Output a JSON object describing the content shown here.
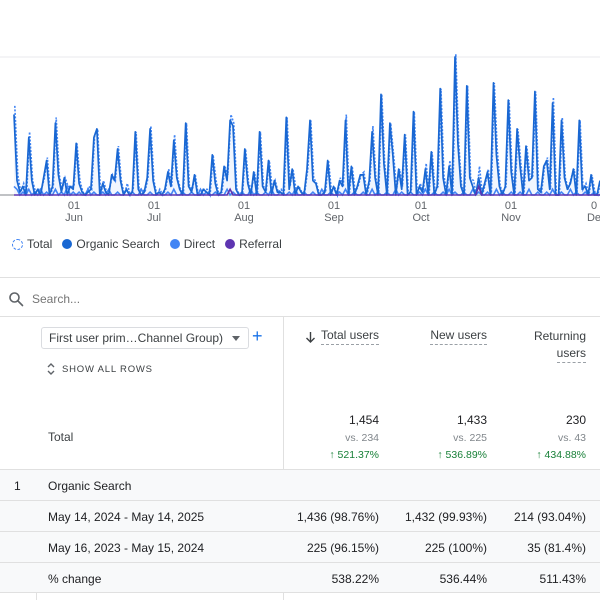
{
  "chart_data": {
    "type": "line",
    "x_ticks": [
      {
        "day": "01",
        "month": "Jun"
      },
      {
        "day": "01",
        "month": "Jul"
      },
      {
        "day": "01",
        "month": "Aug"
      },
      {
        "day": "01",
        "month": "Sep"
      },
      {
        "day": "01",
        "month": "Oct"
      },
      {
        "day": "01",
        "month": "Nov"
      },
      {
        "day": "0",
        "month": "De"
      }
    ],
    "series": [
      {
        "name": "Total",
        "color": "#4285f4",
        "style": "dashed"
      },
      {
        "name": "Organic Search",
        "color": "#1967d2",
        "style": "solid"
      },
      {
        "name": "Direct",
        "color": "#4285f4",
        "style": "solid"
      },
      {
        "name": "Referral",
        "color": "#5e35b1",
        "style": "solid"
      }
    ],
    "organic_values": [
      28,
      5,
      1,
      3,
      0,
      20,
      5,
      0,
      2,
      0,
      6,
      12,
      0,
      3,
      25,
      7,
      1,
      6,
      0,
      3,
      2,
      18,
      4,
      1,
      0,
      1,
      2,
      20,
      23,
      0,
      4,
      1,
      0,
      7,
      5,
      16,
      5,
      0,
      2,
      0,
      1,
      22,
      2,
      0,
      1,
      6,
      23,
      5,
      0,
      1,
      0,
      2,
      8,
      3,
      19,
      6,
      2,
      0,
      25,
      3,
      1,
      7,
      0,
      0,
      2,
      1,
      0,
      14,
      4,
      0,
      1,
      10,
      5,
      26,
      24,
      2,
      0,
      0,
      16,
      4,
      0,
      8,
      0,
      22,
      3,
      1,
      12,
      0,
      5,
      1,
      1,
      0,
      27,
      2,
      9,
      0,
      3,
      1,
      0,
      9,
      26,
      5,
      4,
      0,
      0,
      1,
      12,
      0,
      3,
      0,
      5,
      3,
      26,
      0,
      10,
      0,
      3,
      7,
      7,
      0,
      5,
      22,
      6,
      0,
      35,
      11,
      0,
      25,
      14,
      0,
      9,
      2,
      21,
      0,
      1,
      29,
      0,
      3,
      1,
      9,
      0,
      15,
      0,
      3,
      37,
      6,
      0,
      10,
      0,
      48,
      18,
      3,
      0,
      38,
      6,
      3,
      0,
      6,
      0,
      4,
      8,
      0,
      39,
      14,
      3,
      0,
      3,
      33,
      8,
      0,
      23,
      10,
      0,
      17,
      5,
      6,
      36,
      2,
      1,
      10,
      12,
      2,
      32,
      0,
      0,
      26,
      6,
      2,
      4,
      9,
      0,
      26,
      2,
      3,
      0,
      7,
      0,
      0,
      5
    ],
    "direct_values": [
      3,
      2,
      0,
      1,
      0,
      2,
      0,
      1,
      0,
      2,
      0,
      1,
      0,
      0,
      2,
      0,
      1,
      0,
      3,
      0,
      1,
      0,
      1,
      0,
      0,
      2,
      0,
      1,
      0,
      0,
      1,
      0,
      2,
      0,
      0,
      1,
      0,
      0,
      2,
      0,
      1,
      0,
      0,
      2,
      0,
      0,
      1,
      0,
      0,
      1,
      0,
      0,
      1,
      0,
      2,
      0,
      0,
      1,
      0,
      0,
      1,
      0,
      0,
      2,
      0,
      1,
      0,
      0,
      1,
      0,
      0,
      0,
      2,
      0,
      1,
      0,
      0,
      1,
      0,
      0,
      2,
      0,
      1,
      0,
      0,
      1,
      0,
      2,
      0,
      0,
      1,
      0,
      0,
      1,
      0,
      2,
      0,
      0,
      1,
      0,
      0,
      1,
      0,
      0,
      2,
      0,
      0,
      1,
      0,
      0,
      1,
      0,
      2,
      0,
      0,
      1,
      0,
      0,
      1,
      0,
      0,
      2,
      0,
      1,
      0,
      0,
      1,
      0,
      0,
      2,
      0,
      1,
      0,
      0,
      1,
      0,
      0,
      1,
      0,
      2,
      0,
      0,
      1,
      0,
      0,
      1,
      0,
      2,
      0,
      1,
      0,
      0,
      1,
      0,
      0,
      2,
      0,
      1,
      0,
      0,
      1,
      0,
      0,
      2,
      0,
      1,
      0,
      0,
      1,
      0,
      0,
      1,
      0,
      0,
      2,
      0,
      0,
      1,
      0,
      0,
      1,
      0,
      2,
      0,
      0,
      1,
      0,
      0,
      2,
      0,
      1,
      0,
      0,
      1,
      0,
      0,
      1,
      0,
      0,
      2
    ],
    "referral_values": [
      0,
      0,
      0,
      0,
      0,
      0,
      0,
      0,
      0,
      0,
      0,
      0,
      0,
      0,
      0,
      0,
      0,
      0,
      0,
      0,
      0,
      0,
      0,
      0,
      0,
      0,
      0,
      0,
      0,
      0,
      0,
      0,
      0,
      0,
      0,
      0,
      0,
      0,
      0,
      0,
      0,
      0,
      0,
      0,
      0,
      0,
      0,
      0,
      0,
      0,
      0,
      0,
      0,
      0,
      0,
      0,
      0,
      0,
      0,
      0,
      0,
      0,
      0,
      0,
      0,
      0,
      0,
      0,
      0,
      0,
      0,
      0,
      0,
      2,
      0,
      0,
      0,
      0,
      0,
      0,
      0,
      0,
      0,
      0,
      0,
      0,
      0,
      0,
      0,
      0,
      0,
      0,
      0,
      0,
      0,
      0,
      0,
      0,
      0,
      0,
      0,
      0,
      0,
      0,
      0,
      0,
      0,
      0,
      0,
      0,
      0,
      0,
      0,
      0,
      0,
      0,
      0,
      0,
      0,
      0,
      0,
      0,
      0,
      0,
      0,
      0,
      0,
      0,
      0,
      0,
      0,
      0,
      0,
      0,
      0,
      0,
      0,
      0,
      0,
      0,
      0,
      0,
      0,
      0,
      0,
      0,
      0,
      0,
      0,
      0,
      0,
      0,
      0,
      0,
      0,
      0,
      0,
      3,
      0,
      0,
      0,
      0,
      0,
      0,
      0,
      0,
      0,
      0,
      0,
      0,
      0,
      0,
      0,
      0,
      0,
      0,
      0,
      0,
      0,
      0,
      0,
      0,
      0,
      0,
      0,
      0,
      0,
      0,
      0,
      0,
      0,
      0,
      0,
      0,
      0,
      0,
      0,
      0,
      0,
      0
    ],
    "ylim": [
      0,
      48
    ]
  },
  "legend": [
    {
      "label": "Total",
      "color": "#4285f4",
      "style": "dashed"
    },
    {
      "label": "Organic Search",
      "color": "#1967d2",
      "style": "solid"
    },
    {
      "label": "Direct",
      "color": "#4285f4",
      "style": "solid"
    },
    {
      "label": "Referral",
      "color": "#5e35b1",
      "style": "solid"
    }
  ],
  "search": {
    "placeholder": "Search..."
  },
  "table": {
    "dimension_select": "First user prim…Channel Group)",
    "show_all_rows": "SHOW ALL ROWS",
    "columns": [
      {
        "label": "Total users",
        "sorted": true
      },
      {
        "label": "New users"
      },
      {
        "label_line1": "Returning",
        "label_line2": "users"
      }
    ],
    "total": {
      "label": "Total",
      "values": [
        "1,454",
        "1,433",
        "230"
      ],
      "compare": [
        "vs. 234",
        "vs. 225",
        "vs. 43"
      ],
      "change": [
        "521.37%",
        "536.89%",
        "434.88%"
      ]
    },
    "rows": [
      {
        "index": "1",
        "label": "Organic Search",
        "values": [
          "",
          "",
          ""
        ]
      },
      {
        "index": "",
        "label": "May 14, 2024 - May 14, 2025",
        "values": [
          "1,436 (98.76%)",
          "1,432 (99.93%)",
          "214 (93.04%)"
        ]
      },
      {
        "index": "",
        "label": "May 16, 2023 - May 15, 2024",
        "values": [
          "225 (96.15%)",
          "225 (100%)",
          "35 (81.4%)"
        ]
      },
      {
        "index": "",
        "label": "% change",
        "values": [
          "538.22%",
          "536.44%",
          "511.43%"
        ]
      }
    ]
  }
}
